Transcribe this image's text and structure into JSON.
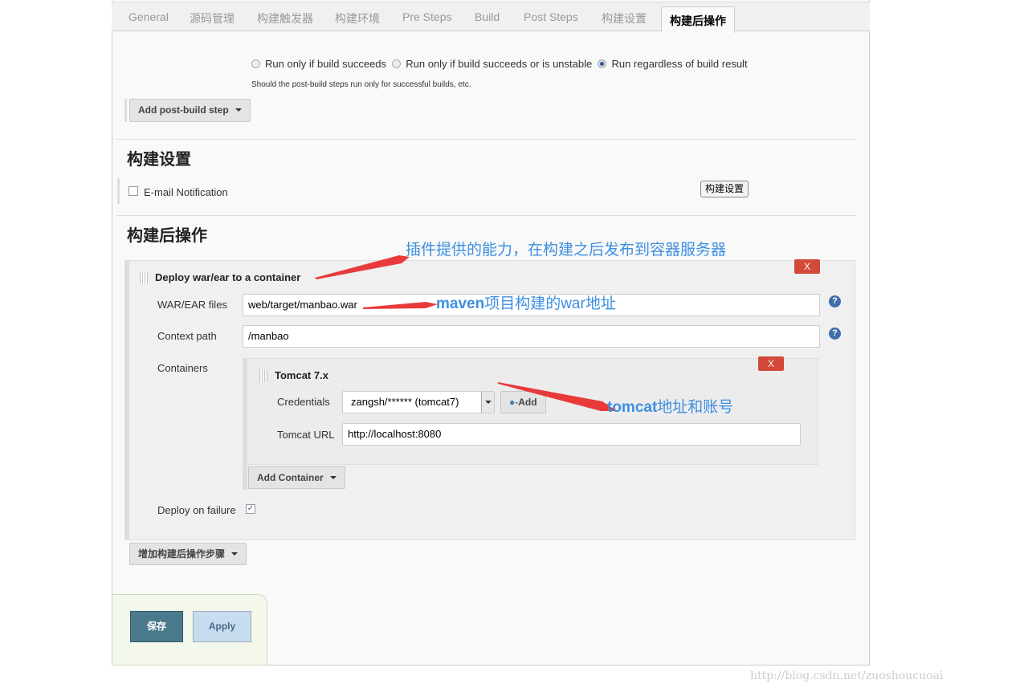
{
  "tabs": [
    "General",
    "源码管理",
    "构建触发器",
    "构建环境",
    "Pre Steps",
    "Build",
    "Post Steps",
    "构建设置",
    "构建后操作"
  ],
  "active_tab": "构建后操作",
  "post_steps": {
    "radios": [
      {
        "label": "Run only if build succeeds",
        "checked": false
      },
      {
        "label": "Run only if build succeeds or is unstable",
        "checked": false
      },
      {
        "label": "Run regardless of build result",
        "checked": true
      }
    ],
    "help": "Should the post-build steps run only for successful builds, etc.",
    "add_button": "Add post-build step"
  },
  "build_settings": {
    "title": "构建设置",
    "email_label": "E-mail Notification",
    "email_checked": false,
    "button": "构建设置"
  },
  "post_build": {
    "title": "构建后操作",
    "deploy": {
      "title": "Deploy war/ear to a container",
      "delete": "X",
      "war_label": "WAR/EAR files",
      "war_value": "web/target/manbao.war",
      "context_label": "Context path",
      "context_value": "/manbao",
      "containers_label": "Containers",
      "tomcat": {
        "title": "Tomcat 7.x",
        "delete": "X",
        "cred_label": "Credentials",
        "cred_value": "zangsh/****** (tomcat7)",
        "add_label": "Add",
        "url_label": "Tomcat URL",
        "url_value": "http://localhost:8080"
      },
      "add_container": "Add Container",
      "failure_label": "Deploy on failure",
      "failure_checked": true
    },
    "add_button": "增加构建后操作步骤"
  },
  "footer": {
    "save": "保存",
    "apply": "Apply"
  },
  "annotations": {
    "a1": "插件提供的能力，在构建之后发布到容器服务器",
    "a2_bold": "maven",
    "a2_rest": "项目构建的war地址",
    "a3_bold": "tomcat",
    "a3_rest": "地址和账号"
  },
  "watermark": "http://blog.csdn.net/zuoshoucuoai",
  "colors": {
    "annotation": "#3d8fe0",
    "arrow": "#e83a3a",
    "delete": "#d24939",
    "save": "#4a7a8c"
  }
}
